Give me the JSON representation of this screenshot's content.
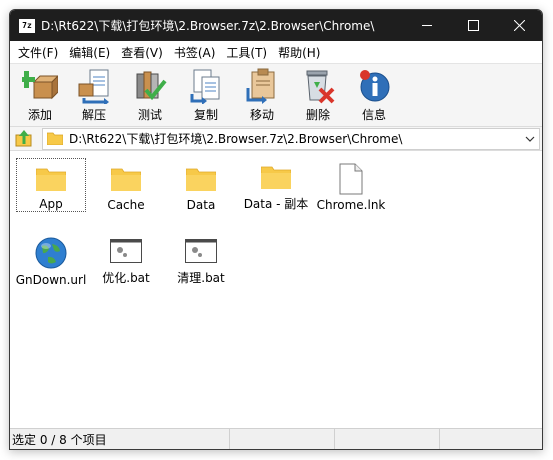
{
  "window": {
    "title": "D:\\Rt622\\下载\\打包环境\\2.Browser.7z\\2.Browser\\Chrome\\",
    "app_icon_text": "7z"
  },
  "menu": [
    "文件(F)",
    "编辑(E)",
    "查看(V)",
    "书签(A)",
    "工具(T)",
    "帮助(H)"
  ],
  "toolbar": [
    {
      "label": "添加",
      "icon": "add-icon"
    },
    {
      "label": "解压",
      "icon": "extract-icon"
    },
    {
      "label": "测试",
      "icon": "test-icon"
    },
    {
      "label": "复制",
      "icon": "copy-icon"
    },
    {
      "label": "移动",
      "icon": "move-icon"
    },
    {
      "label": "删除",
      "icon": "delete-icon"
    },
    {
      "label": "信息",
      "icon": "info-icon"
    }
  ],
  "address": {
    "path": "D:\\Rt622\\下载\\打包环境\\2.Browser.7z\\2.Browser\\Chrome\\"
  },
  "files": [
    {
      "name": "App",
      "type": "folder",
      "selected": true
    },
    {
      "name": "Cache",
      "type": "folder"
    },
    {
      "name": "Data",
      "type": "folder"
    },
    {
      "name": "Data - 副本",
      "type": "folder"
    },
    {
      "name": "Chrome.lnk",
      "type": "file"
    },
    {
      "name": "GnDown.url",
      "type": "url"
    },
    {
      "name": "优化.bat",
      "type": "bat"
    },
    {
      "name": "清理.bat",
      "type": "bat"
    }
  ],
  "status": {
    "text": "选定 0 / 8 个项目"
  },
  "colors": {
    "titlebar": "#1e1e1e",
    "folder": "#f7c948",
    "folder_dark": "#e0a92a",
    "toolbar_bg": "#f5f5f5"
  }
}
